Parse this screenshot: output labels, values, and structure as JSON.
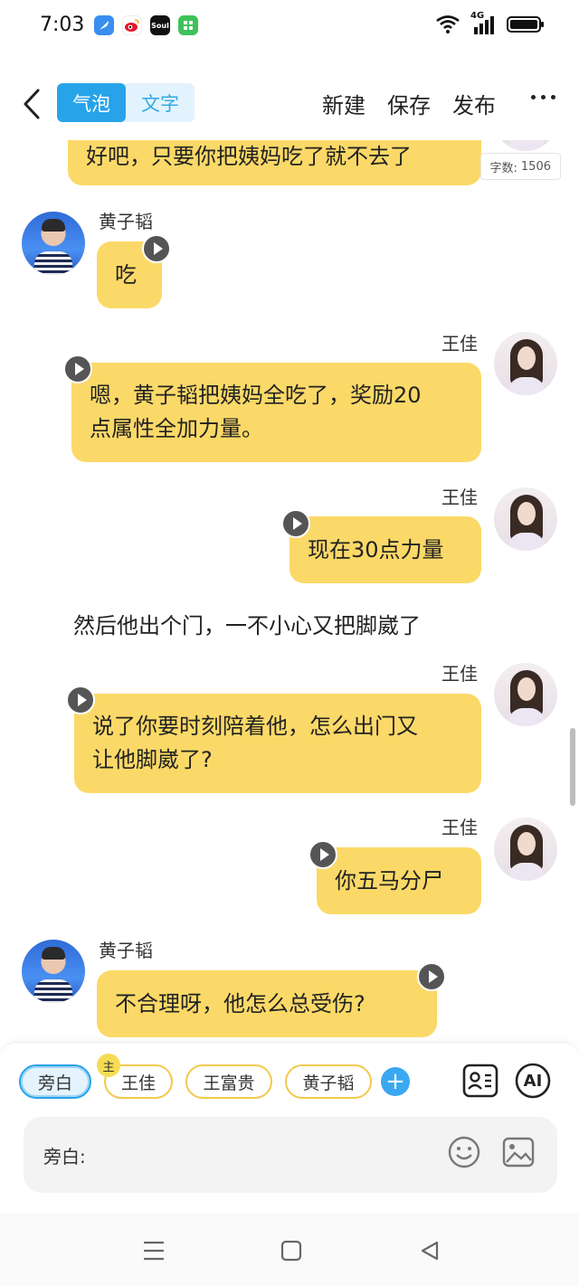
{
  "status_bar": {
    "time": "7:03",
    "apps": [
      "feather-app-icon",
      "weibo-app-icon",
      "soul-app-icon",
      "green-app-icon"
    ],
    "soul_label": "Soul",
    "network": "4G"
  },
  "toolbar": {
    "seg_bubble": "气泡",
    "seg_text": "文字",
    "new_label": "新建",
    "save_label": "保存",
    "publish_label": "发布"
  },
  "word_count": {
    "label": "字数:",
    "value": "1506"
  },
  "messages": [
    {
      "side": "right",
      "text": "好吧，只要你把姨妈吃了就不去了"
    },
    {
      "side": "left",
      "name": "黄子韬",
      "text": "吃"
    },
    {
      "side": "right",
      "name": "王佳",
      "text_line1": "嗯，黄子韬把姨妈全吃了，奖励20",
      "text_line2": "点属性全加力量。"
    },
    {
      "side": "right",
      "name": "王佳",
      "text": "现在30点力量"
    },
    {
      "side": "narration",
      "text": "然后他出个门，一不小心又把脚崴了"
    },
    {
      "side": "right",
      "name": "王佳",
      "text_line1": "说了你要时刻陪着他，怎么出门又",
      "text_line2": "让他脚崴了?"
    },
    {
      "side": "right",
      "name": "王佳",
      "text": "你五马分尸"
    },
    {
      "side": "left",
      "name": "黄子韬",
      "text": "不合理呀，他怎么总受伤?"
    }
  ],
  "composer": {
    "roles": [
      "旁白",
      "王佳",
      "王富贵",
      "黄子韬"
    ],
    "main_badge": "主",
    "ai_label": "AI",
    "input_label": "旁白:"
  },
  "colors": {
    "bubble": "#fbd968",
    "accent": "#27a3ea",
    "chip_border": "#f2c94c"
  }
}
